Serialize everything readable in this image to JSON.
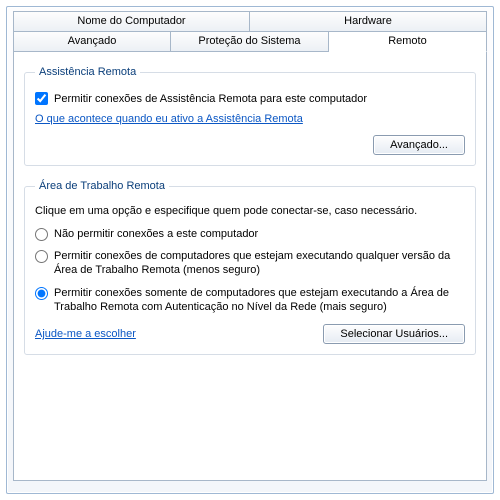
{
  "tabs": {
    "row1": [
      {
        "label": "Nome do Computador"
      },
      {
        "label": "Hardware"
      }
    ],
    "row2": [
      {
        "label": "Avançado"
      },
      {
        "label": "Proteção do Sistema"
      },
      {
        "label": "Remoto",
        "active": true
      }
    ]
  },
  "assistencia": {
    "legend": "Assistência Remota",
    "checkbox_label": "Permitir conexões de Assistência Remota para este computador",
    "checkbox_checked": true,
    "help_link": "O que acontece quando eu ativo a Assistência Remota",
    "advanced_button": "Avançado..."
  },
  "rdp": {
    "legend": "Área de Trabalho Remota",
    "description": "Clique em uma opção e especifique quem pode conectar-se, caso necessário.",
    "options": [
      "Não permitir conexões a este computador",
      "Permitir conexões de computadores que estejam executando qualquer versão da Área de Trabalho Remota (menos seguro)",
      "Permitir conexões somente de computadores que estejam executando a Área de Trabalho Remota com Autenticação no Nível da Rede (mais seguro)"
    ],
    "selected_index": 2,
    "help_link": "Ajude-me a escolher",
    "select_users_button": "Selecionar Usuários..."
  }
}
